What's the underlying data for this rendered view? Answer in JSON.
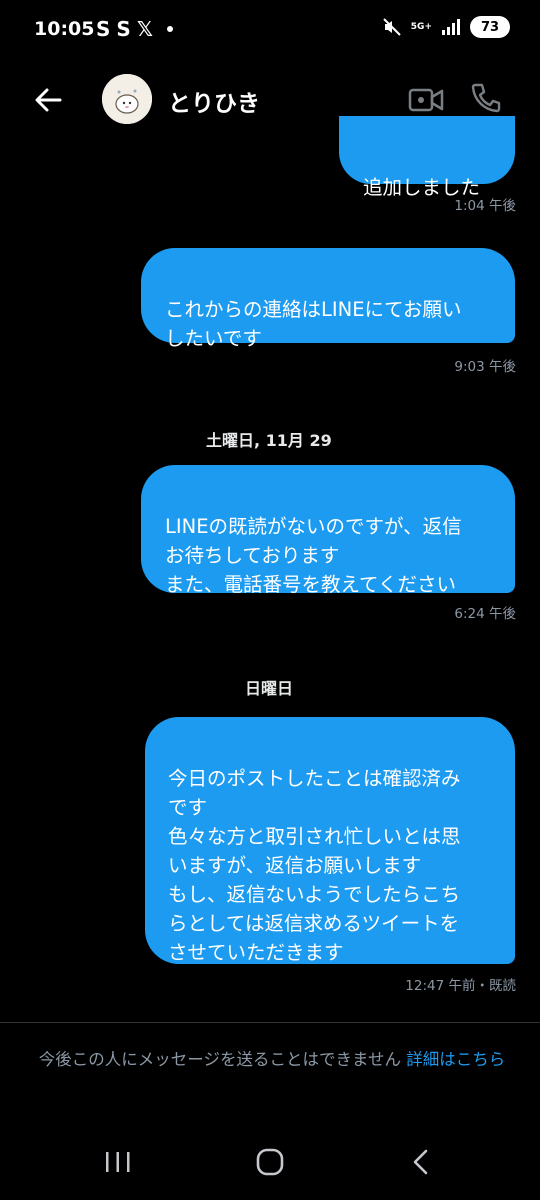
{
  "status": {
    "time": "10:05",
    "app_icons": [
      "S",
      "S",
      "𝕏"
    ],
    "network": "5G+",
    "battery": "73"
  },
  "header": {
    "title": "とりひき"
  },
  "messages": [
    {
      "text": "追加しました",
      "time": "1:04 午後"
    },
    {
      "text": "これからの連絡はLINEにてお願い\nしたいです",
      "time": "9:03 午後"
    },
    {
      "text": "LINEの既読がないのですが、返信\nお待ちしております\nまた、電話番号を教えてください",
      "time": "6:24 午後"
    },
    {
      "text": "今日のポストしたことは確認済み\nです\n色々な方と取引され忙しいとは思\nいますが、返信お願いします\nもし、返信ないようでしたらこち\nらとしては返信求めるツイートを\nさせていただきます",
      "time": "12:47 午前・既読"
    }
  ],
  "days": [
    "土曜日, 11月 29",
    "日曜日"
  ],
  "footer": {
    "notice": "今後この人にメッセージを送ることはできません",
    "link": "詳細はこちら"
  },
  "colors": {
    "bubble": "#1d9bf0",
    "background": "#000000",
    "muted": "#8b98a5"
  }
}
